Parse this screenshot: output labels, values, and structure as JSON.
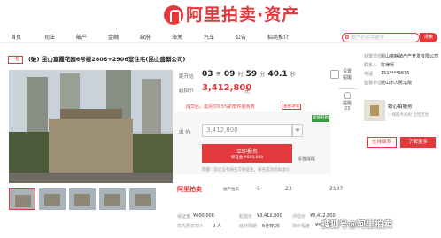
{
  "brand": {
    "logo_text": "阿里拍卖·资产"
  },
  "nav": {
    "items": [
      "首页",
      "司法",
      "破产",
      "金融",
      "政府",
      "海关",
      "汽车",
      "公告",
      "招商推介"
    ],
    "search_placeholder": "资产名称/关键字",
    "search_button": "搜索"
  },
  "listing": {
    "badge": "一拍",
    "title": "(破) 昆山富霞花园6号楼2806+2906室住宅(昆山盛麒公司)"
  },
  "bid_panel": {
    "countdown_label": "距开始",
    "countdown": {
      "days": "03",
      "d_unit": "天",
      "hours": "09",
      "h_unit": "时",
      "minutes": "59",
      "m_unit": "分",
      "seconds": "40.1",
      "s_unit": "秒"
    },
    "current_label": "起拍价",
    "current_price": "3,412,800",
    "price_unit": "元",
    "notice_text": "成交后，需另付0.5%的软件服务费",
    "notice_link": "查看详情",
    "green_tag": "即将开始",
    "bid_label": "出 价",
    "bid_value": "3,412,800",
    "plus": "+",
    "register_label": "立即报名",
    "register_sub": "保证金 ¥600,000",
    "remind_link": "设置提醒",
    "tip_text": "提醒：您还没有报名交保证金，报名成功后再出价",
    "logo_small": "阿里拍卖",
    "logo_small_sub": "破产拍卖",
    "stats": {
      "views": "6",
      "remind": "23",
      "watch": "2187"
    },
    "fees": {
      "deposit_label": "保证金",
      "deposit": "¥600,000",
      "start_label": "起拍价",
      "start": "¥3,412,800",
      "assess_label": "评估价",
      "assess": "¥3,412,800",
      "priority_label": "优先购买权人",
      "priority": "0 人",
      "extend_label": "延时周期",
      "extend": "5分钟/次",
      "step_label": "加价幅度",
      "step": "¥5,000"
    }
  },
  "side": {
    "label_top": "设置提醒",
    "remind": "提醒",
    "remind_count": "23"
  },
  "right": {
    "seller_label": "处置单位",
    "seller": "昆山盛麒破产产开发有限公司",
    "contact_label": "联系人",
    "contact": "陈律师",
    "phone_label": "电话",
    "phone": "151****9876",
    "supervisor_label": "监督单位",
    "supervisor": "昆山市人民法院",
    "org_name": "致心拍服务",
    "org_stat": "一线服务机构 全程无忧",
    "contact_button": "在线联系",
    "more_button": "了解更多"
  },
  "watermark": "搜狐号@阿里拍卖"
}
